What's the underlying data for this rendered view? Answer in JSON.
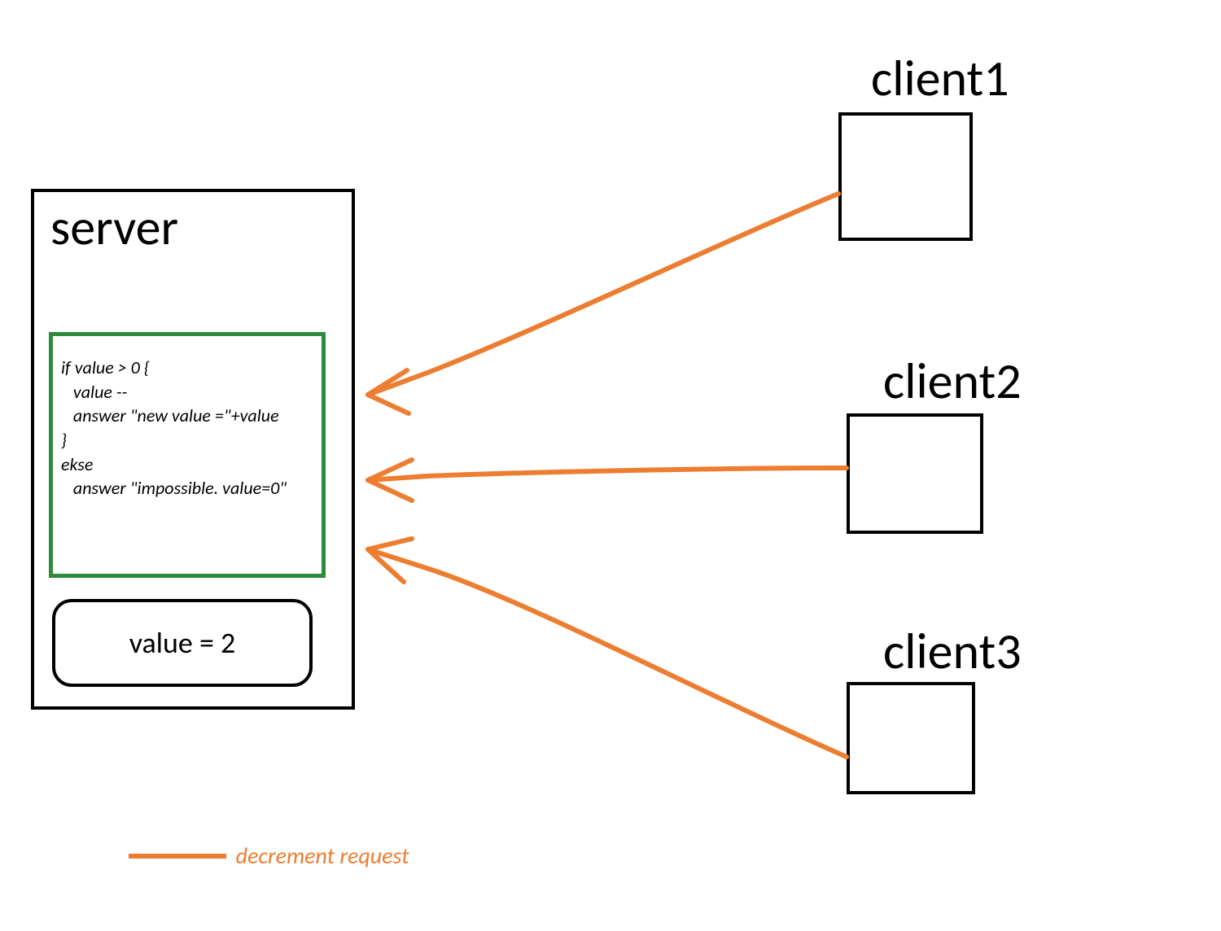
{
  "server": {
    "title": "server",
    "code": "if value > 0 {\n   value --\n   answer \"new value =\"+value\n}\nekse\n   answer \"impossible. value=0\"",
    "value_label": "value = 2"
  },
  "clients": {
    "client1": "client1",
    "client2": "client2",
    "client3": "client3"
  },
  "legend": {
    "text": "decrement request"
  },
  "colors": {
    "arrow": "#ed7d31",
    "code_border": "#2e8b3d",
    "box_border": "#000000"
  }
}
